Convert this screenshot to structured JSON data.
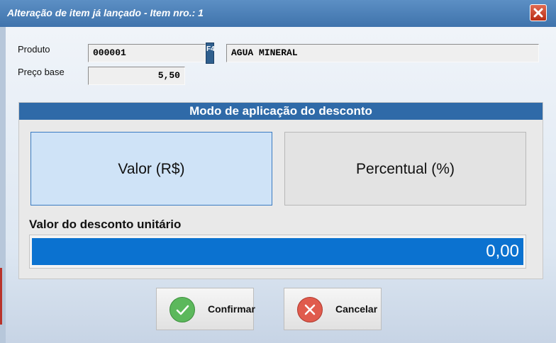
{
  "window": {
    "title": "Alteração de item já lançado - Item nro.: 1"
  },
  "form": {
    "produto_label": "Produto",
    "produto_code": "000001",
    "lookup_key": "F4",
    "produto_name": "AGUA MINERAL",
    "preco_label": "Preço base",
    "preco_value": "5,50"
  },
  "discount": {
    "header": "Modo de aplicação do desconto",
    "mode_valor": "Valor (R$)",
    "mode_percentual": "Percentual (%)",
    "selected_mode": "Valor (R$)",
    "value_label": "Valor do desconto unitário",
    "value": "0,00"
  },
  "actions": {
    "confirm": "Confirmar",
    "cancel": "Cancelar"
  },
  "colors": {
    "titlebar": "#4a7fb8",
    "accent_blue": "#0b72d0",
    "confirm_green": "#5cb85c",
    "cancel_red": "#e05b4d"
  }
}
